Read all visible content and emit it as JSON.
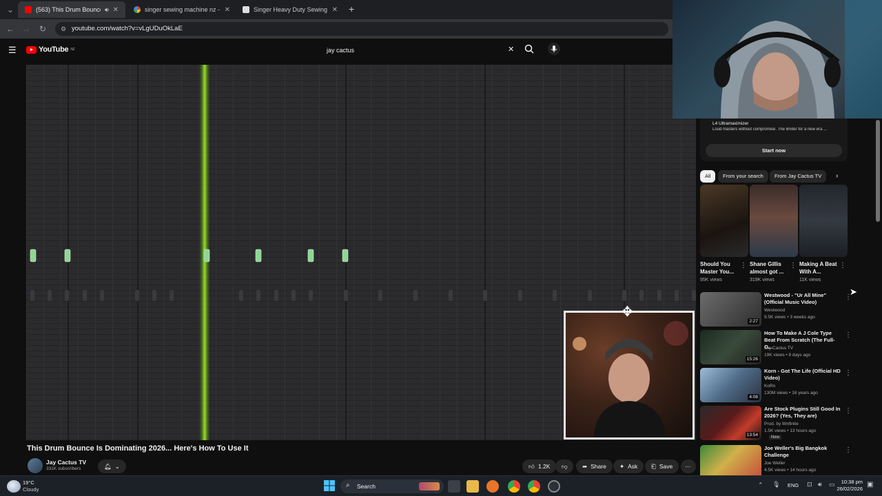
{
  "browser": {
    "tabs": [
      {
        "title": "(563) This Drum Bounce Is D",
        "active": true
      },
      {
        "title": "singer sewing machine nz - Goo",
        "active": false
      },
      {
        "title": "Singer Heavy Duty Sewing Mac",
        "active": false
      }
    ],
    "new_tab": "+",
    "url": "youtube.com/watch?v=vLgUDuOkLaE"
  },
  "youtube": {
    "logo": "YouTube",
    "region": "NZ",
    "search_value": "jay cactus"
  },
  "video": {
    "title": "This Drum Bounce Is Dominating 2026... Here's How To Use It",
    "channel": "Jay Cactus TV",
    "subscribers": "331K subscribers",
    "likes": "1.2K",
    "share": "Share",
    "ask": "Ask",
    "save": "Save"
  },
  "sidebar": {
    "ad": {
      "title": "L4 Ultramaximizer",
      "description": "Loud masters without compromise. The limiter for a new era ...",
      "cta": "Start now"
    },
    "chips": [
      "All",
      "From your search",
      "From Jay Cactus TV"
    ],
    "shorts": [
      {
        "title": "Should You Master You...",
        "views": "95K views"
      },
      {
        "title": "Shane Gillis almost got ...",
        "views": "319K views"
      },
      {
        "title": "Making A Beat With A...",
        "views": "11K views"
      }
    ],
    "recommended": [
      {
        "title": "Westwood - \"Ur All Mine\" (Official Music Video)",
        "channel": "Westwood",
        "meta": "9.5K views • 3 weeks ago",
        "duration": "2:27"
      },
      {
        "title": "How To Make A J Cole Type Beat From Scratch (The Full-O...",
        "channel": "Jay Cactus TV",
        "meta": "19K views • 8 days ago",
        "duration": "15:26"
      },
      {
        "title": "Korn - Got The Life (Official HD Video)",
        "channel": "KoRn",
        "meta": "130M views • 16 years ago",
        "duration": "4:08"
      },
      {
        "title": "Are Stock Plugins Still Good In 2026? (Yes, They are)",
        "channel": "Prod. by Illmfinite",
        "meta": "1.5K views • 13 hours ago",
        "duration": "13:54",
        "badge": "New"
      },
      {
        "title": "Joe Weller's Big Bangkok Challenge",
        "channel": "Joe Weller",
        "meta": "4.5K views • 14 hours ago",
        "duration": ""
      }
    ]
  },
  "taskbar": {
    "weather_temp": "19°C",
    "weather_desc": "Cloudy",
    "search": "Search",
    "lang": "ENG",
    "time": "10:38 pm",
    "date": "26/02/2026"
  }
}
